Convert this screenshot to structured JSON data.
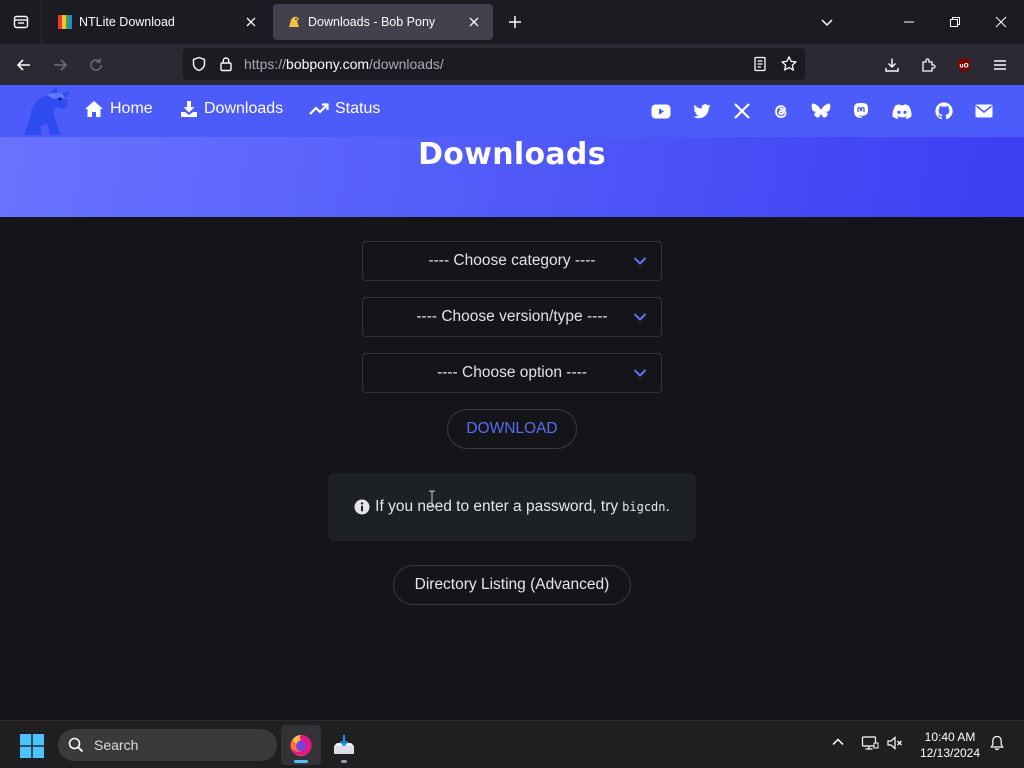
{
  "browser": {
    "tabs": [
      {
        "title": "NTLite Download",
        "active": false
      },
      {
        "title": "Downloads - Bob Pony",
        "active": true
      }
    ],
    "url": {
      "prefix": "https://",
      "host": "bobpony.com",
      "path": "/downloads/"
    }
  },
  "site": {
    "nav": [
      {
        "label": "Home",
        "icon": "home-icon"
      },
      {
        "label": "Downloads",
        "icon": "download-icon"
      },
      {
        "label": "Status",
        "icon": "trending-icon"
      }
    ],
    "social_icons": [
      "youtube-icon",
      "twitter-icon",
      "x-icon",
      "threads-icon",
      "bluesky-icon",
      "mastodon-icon",
      "discord-icon",
      "github-icon",
      "email-icon"
    ],
    "page_title": "Downloads",
    "colors": {
      "header": "#4c5cfb",
      "accent": "#5a6cf0",
      "background": "#15141a"
    }
  },
  "form": {
    "category_placeholder": "---- Choose category ----",
    "version_placeholder": "---- Choose version/type ----",
    "option_placeholder": "---- Choose option ----",
    "download_label": "DOWNLOAD",
    "notice_text": "If you need to enter a password, try",
    "notice_code": "bigcdn",
    "notice_end": ".",
    "directory_label": "Directory Listing (Advanced)"
  },
  "taskbar": {
    "search_label": "Search",
    "time": "10:40 AM",
    "date": "12/13/2024"
  }
}
